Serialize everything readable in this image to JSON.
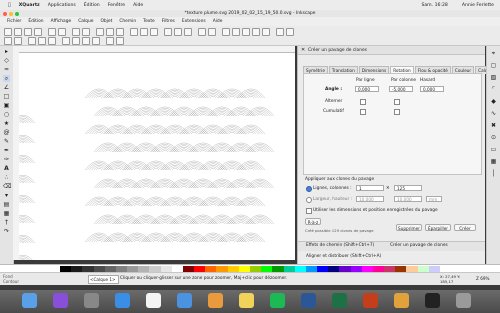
{
  "macmenu": {
    "items": [
      "XQuartz",
      "Applications",
      "Édition",
      "Fenêtre",
      "Aide"
    ],
    "right_time": "Sam. 16:28",
    "right_user": "Annie Ferlette"
  },
  "window": {
    "title": "*texture plume.svg 2019_02_02_15_19_50.0.svg - Inkscape"
  },
  "menubar": {
    "items": [
      "Fichier",
      "Édition",
      "Affichage",
      "Calque",
      "Objet",
      "Chemin",
      "Texte",
      "Filtres",
      "Extensions",
      "Aide"
    ]
  },
  "panel": {
    "title": "Créer un pavage de clones",
    "tabs": [
      "Symétrie",
      "Translation",
      "Dimensions",
      "Rotation",
      "Flou & opacité",
      "Couleur",
      "Calquer"
    ],
    "active_tab": "Rotation",
    "headers": [
      "Par ligne",
      "Par colonne",
      "Hasard"
    ],
    "rows": {
      "angle": {
        "label": "Angle :",
        "v1": "0,000",
        "v2": "-5,000",
        "v3": "0,000"
      },
      "alterner": {
        "label": "Alterner"
      },
      "cumulatif": {
        "label": "Cumulatif"
      }
    },
    "apply_title": "Appliquer aux clones du pavage",
    "radio1": "Lignes, colonnes :",
    "rows_value": "1",
    "cols_value": "125",
    "radio2": "Largeur, hauteur :",
    "width_value": "10,000",
    "height_value": "10,000",
    "unit": "mm",
    "use_dims": "Utiliser les dimensions et position enregistrées du pavage",
    "reset_button": "R-à-z",
    "info": "Créé possible 129 clones de pavage",
    "delete_button": "Supprimer",
    "disperse_button": "Éparpiller",
    "create_button": "Créer",
    "footer_left": "Effets de chemin (Shift+Ctrl+7)",
    "footer_right": "Créer un pavage de clones",
    "footer2": "Aligner et distribuer (Shift+Ctrl+A)"
  },
  "status": {
    "layer": "<Calque 1>",
    "message": "Cliquer ou cliquer-glisser sur une zone pour zoomer, Maj+clic pour dézoomer.",
    "coords": "X: 27,49 Y: 185,17",
    "zoom": "Z 69%"
  },
  "colors": {
    "accent": "#4a7fd6",
    "palette": [
      "#000000",
      "#1a1a1a",
      "#333333",
      "#4d4d4d",
      "#666666",
      "#808080",
      "#999999",
      "#b3b3b3",
      "#cccccc",
      "#e6e6e6",
      "#ffffff",
      "#800000",
      "#ff0000",
      "#ff6600",
      "#ff9900",
      "#ffcc00",
      "#ffff00",
      "#99cc00",
      "#00ff00",
      "#009900",
      "#00cc99",
      "#00ffff",
      "#0099ff",
      "#0000ff",
      "#000080",
      "#6600cc",
      "#9900ff",
      "#ff00ff",
      "#ff0099",
      "#cc3366",
      "#993300",
      "#ffcc99",
      "#ccffcc",
      "#ccccff"
    ]
  },
  "dock": {
    "icons": [
      "finder-icon",
      "siri-icon",
      "launchpad-icon",
      "safari-icon",
      "calendar-icon",
      "mail-icon",
      "photos-icon",
      "notes-icon",
      "spotify-icon",
      "word-icon",
      "excel-icon",
      "powerpoint-icon",
      "inkscape-icon",
      "terminal-icon",
      "trash-icon"
    ]
  }
}
